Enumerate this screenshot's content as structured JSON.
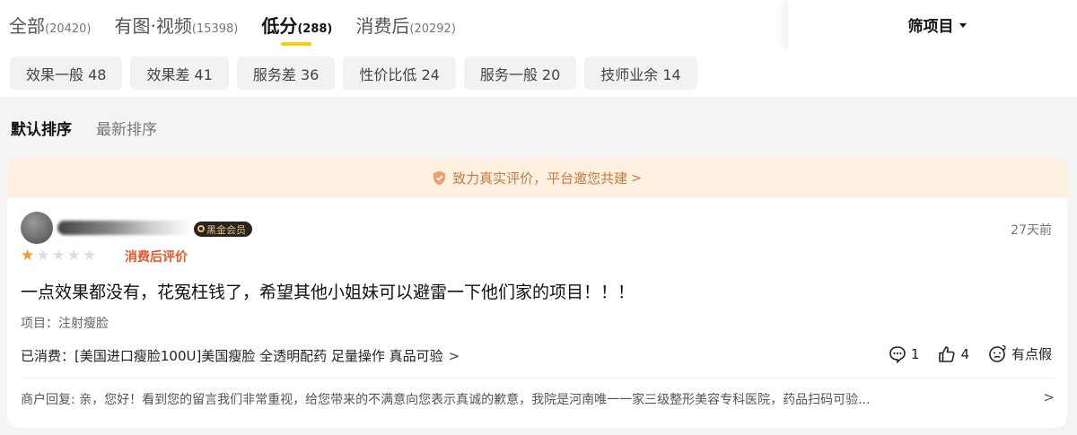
{
  "tabs": [
    {
      "label": "全部",
      "count": "(20420)"
    },
    {
      "label": "有图·视频",
      "count": "(15398)"
    },
    {
      "label": "低分",
      "count": "(288)"
    },
    {
      "label": "消费后",
      "count": "(20292)"
    }
  ],
  "filter": {
    "label": "筛项目",
    "icon": "caret-down-icon"
  },
  "tags": [
    "效果一般 48",
    "效果差 41",
    "服务差 36",
    "性价比低 24",
    "服务一般 20",
    "技师业余 14"
  ],
  "sort": {
    "default": "默认排序",
    "newest": "最新排序"
  },
  "banner": {
    "text": "致力真实评价，平台邀您共建",
    "chevron": ">",
    "icon": "shield-icon",
    "color": "#c87a3f"
  },
  "review": {
    "badge": "黑金会员",
    "time": "27天前",
    "rating": 1,
    "max_rating": 5,
    "post_tag": "消费后评价",
    "content": "一点效果都没有，花冤枉钱了，希望其他小姐妹可以避雷一下他们家的项目！！！",
    "project": "项目：注射瘦脸",
    "consumed_label": "已消费：",
    "consumed_item": "[美国进口瘦脸100U]美国瘦脸 全透明配药 足量操作 真品可验",
    "consumed_chevron": ">",
    "comments": "1",
    "likes": "4",
    "suspicious": "有点假",
    "reply": "商户回复: 亲，您好！看到您的留言我们非常重视，给您带来的不满意向您表示真诚的歉意，我院是河南唯一一家三级整形美容专科医院，药品扫码可验...",
    "reply_chevron": ">"
  },
  "colors": {
    "accent": "#ffcc00",
    "star": "#f79a28",
    "post_tag": "#e8542a"
  }
}
